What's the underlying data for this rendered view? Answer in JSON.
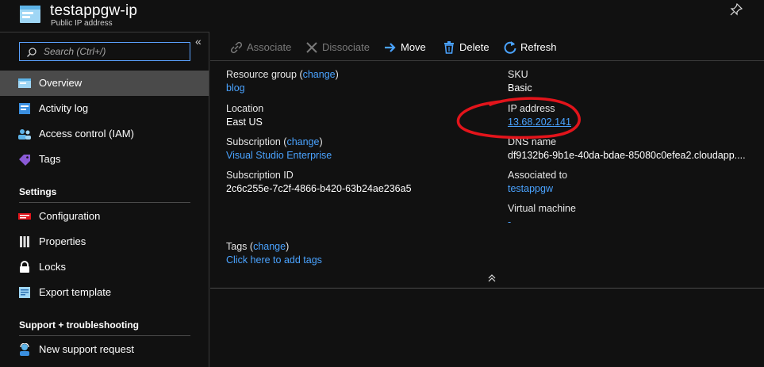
{
  "header": {
    "title": "testappgw-ip",
    "subtitle": "Public IP address"
  },
  "sidebar": {
    "search_placeholder": "Search (Ctrl+/)",
    "items": [
      {
        "label": "Overview",
        "active": true
      },
      {
        "label": "Activity log"
      },
      {
        "label": "Access control (IAM)"
      },
      {
        "label": "Tags"
      }
    ],
    "settings_heading": "Settings",
    "settings_items": [
      {
        "label": "Configuration"
      },
      {
        "label": "Properties"
      },
      {
        "label": "Locks"
      },
      {
        "label": "Export template"
      }
    ],
    "support_heading": "Support + troubleshooting",
    "support_items": [
      {
        "label": "New support request"
      }
    ]
  },
  "toolbar": {
    "associate": "Associate",
    "dissociate": "Dissociate",
    "move": "Move",
    "delete": "Delete",
    "refresh": "Refresh"
  },
  "essentials": {
    "resource_group_label": "Resource group",
    "change": "change",
    "resource_group": "blog",
    "location_label": "Location",
    "location": "East US",
    "subscription_label": "Subscription",
    "subscription": "Visual Studio Enterprise",
    "subscription_id_label": "Subscription ID",
    "subscription_id": "2c6c255e-7c2f-4866-b420-63b24ae236a5",
    "sku_label": "SKU",
    "sku": "Basic",
    "ip_label": "IP address",
    "ip": "13.68.202.141",
    "dns_label": "DNS name",
    "dns": "df9132b6-9b1e-40da-bdae-85080c0efea2.cloudapp....",
    "associated_label": "Associated to",
    "associated": "testappgw",
    "vm_label": "Virtual machine",
    "vm": "-",
    "tags_label": "Tags",
    "tags_link": "Click here to add tags"
  },
  "colors": {
    "accent": "#4aa3ff",
    "annotation": "#e3141b",
    "active_nav": "#4a4a4a"
  }
}
